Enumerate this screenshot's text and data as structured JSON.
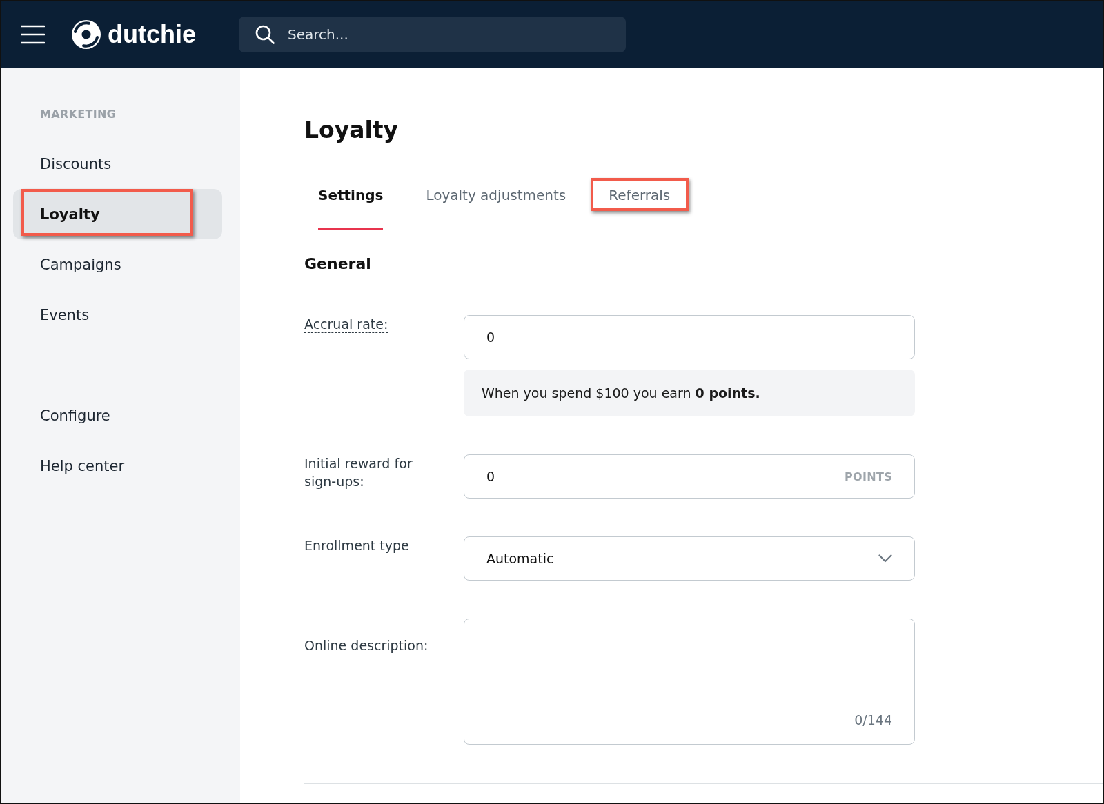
{
  "top_bar": {
    "logo_text": "dutchie",
    "search": {
      "placeholder": "Search..."
    }
  },
  "sidebar": {
    "heading": "MARKETING",
    "items": [
      {
        "label": "Discounts",
        "selected": false,
        "highlighted": false
      },
      {
        "label": "Loyalty",
        "selected": true,
        "highlighted": true
      },
      {
        "label": "Campaigns",
        "selected": false,
        "highlighted": false
      },
      {
        "label": "Events",
        "selected": false,
        "highlighted": false
      }
    ],
    "footer_items": [
      {
        "label": "Configure",
        "selected": false
      },
      {
        "label": "Help center",
        "selected": false
      }
    ]
  },
  "page": {
    "title": "Loyalty",
    "tabs": [
      {
        "label": "Settings",
        "selected": true,
        "highlighted": false
      },
      {
        "label": "Loyalty adjustments",
        "selected": false,
        "highlighted": false
      },
      {
        "label": "Referrals",
        "selected": false,
        "highlighted": true
      }
    ],
    "section_title": "General",
    "fields": [
      {
        "kind": "text",
        "label": "Accrual rate:",
        "has_help": true,
        "value": "0",
        "note": "When you spend $100 you earn **0 points.**"
      },
      {
        "kind": "unit",
        "label": "Initial reward for sign-ups:",
        "has_help": false,
        "value": "0",
        "unit": "POINTS"
      },
      {
        "kind": "select",
        "label": "Enrollment type",
        "has_help": true,
        "value": "Automatic"
      },
      {
        "kind": "textarea",
        "label": "Online description:",
        "has_help": false,
        "counter": "0/144"
      }
    ]
  }
}
